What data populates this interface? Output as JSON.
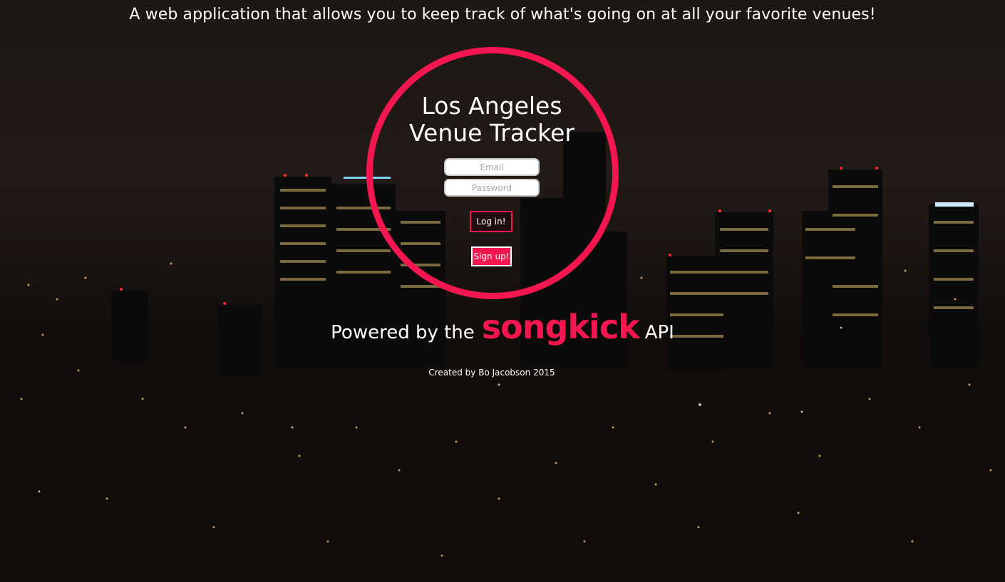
{
  "header": {
    "tagline": "A web application that allows you to keep track of what's going on at all your favorite venues!"
  },
  "login_card": {
    "title_line1": "Los Angeles",
    "title_line2": "Venue Tracker",
    "email_placeholder": "Email",
    "password_placeholder": "Password",
    "login_label": "Log in!",
    "signup_label": "Sign up!"
  },
  "footer": {
    "powered_prefix": "Powered by the",
    "brand": "songkick",
    "powered_suffix": "API",
    "credit": "Created by Bo Jacobson 2015"
  },
  "theme": {
    "accent": "#f4164e",
    "text": "#ffffff"
  }
}
